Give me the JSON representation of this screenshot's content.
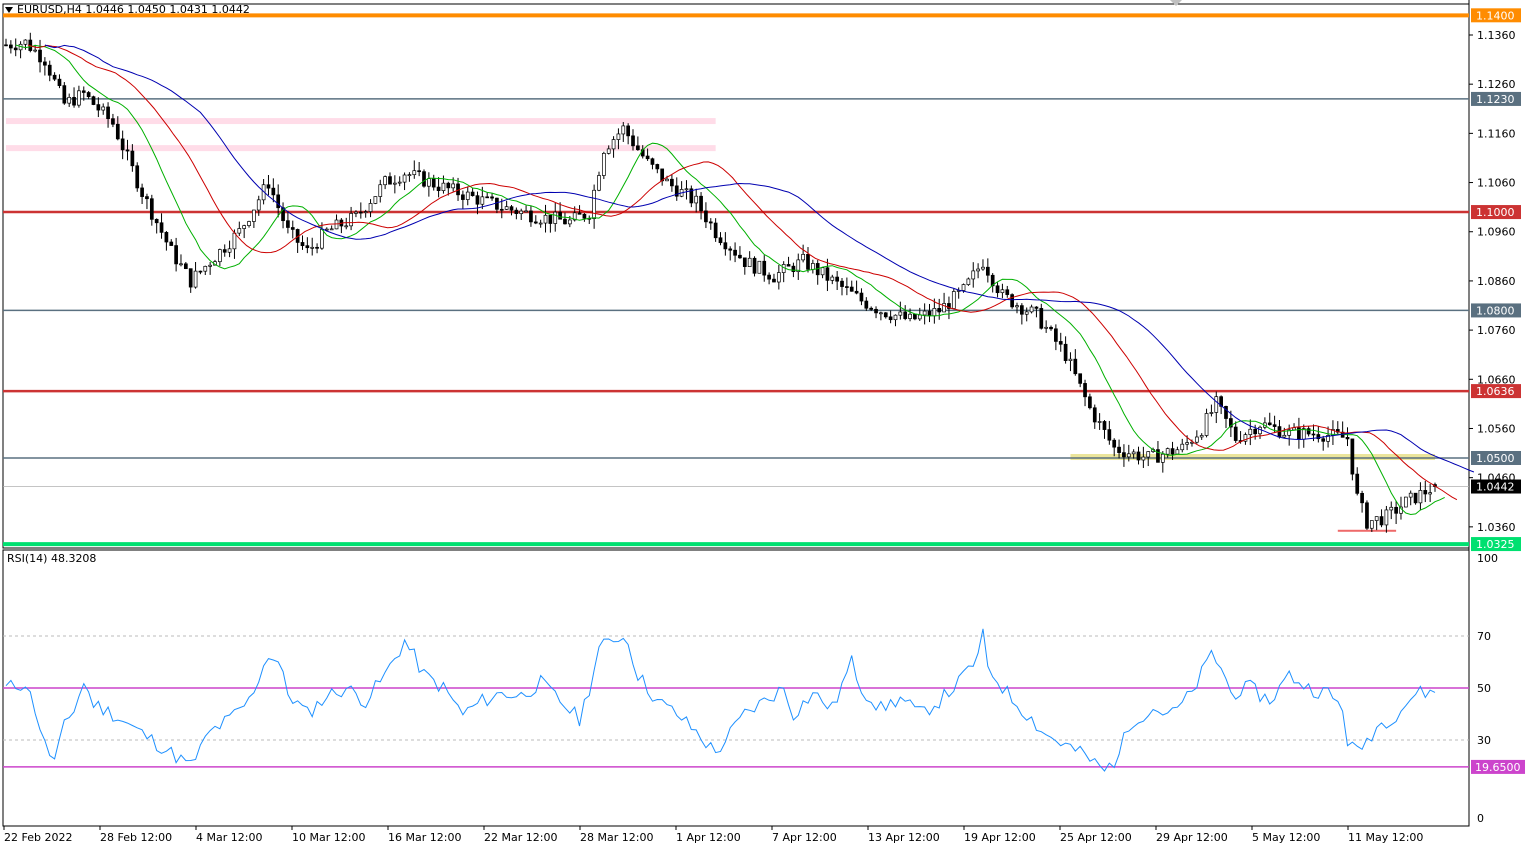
{
  "header": {
    "symbol_line": "EURUSD,H4  1.0446 1.0450 1.0431 1.0442"
  },
  "rsi_header": {
    "text": "RSI(14) 48.3208"
  },
  "colors": {
    "candle": "#000000",
    "ma_green": "#00b000",
    "ma_red": "#cc0000",
    "ma_blue": "#0000b0",
    "rsi_line": "#1e90ff",
    "level_orange": "#ff8c00",
    "level_red": "#cc3333",
    "level_gray": "#5a7080",
    "level_green": "#00e070",
    "rsi_level_magenta": "#cc44cc",
    "zone_pink": "#ffd6e4",
    "zone_yellow": "#e8e08a"
  },
  "chart_data": [
    {
      "type": "candlestick",
      "title": "EURUSD,H4",
      "timeframe": "H4",
      "ohlc_last": {
        "open": 1.0446,
        "high": 1.045,
        "low": 1.0431,
        "close": 1.0442
      },
      "current_price_label": "1.0442",
      "ylim": [
        1.0325,
        1.141
      ],
      "y_ticks": [
        "1.1360",
        "1.1260",
        "1.1160",
        "1.1060",
        "1.0960",
        "1.0860",
        "1.0760",
        "1.0660",
        "1.0560",
        "1.0460",
        "1.0360"
      ],
      "x_ticks": [
        "22 Feb 2022",
        "28 Feb 12:00",
        "4 Mar 12:00",
        "10 Mar 12:00",
        "16 Mar 12:00",
        "22 Mar 12:00",
        "28 Mar 12:00",
        "1 Apr 12:00",
        "7 Apr 12:00",
        "13 Apr 12:00",
        "19 Apr 12:00",
        "25 Apr 12:00",
        "29 Apr 12:00",
        "5 May 12:00",
        "11 May 12:00"
      ],
      "price_path": [
        [
          0,
          1.134
        ],
        [
          4,
          1.1345
        ],
        [
          8,
          1.131
        ],
        [
          12,
          1.122
        ],
        [
          16,
          1.124
        ],
        [
          22,
          1.118
        ],
        [
          28,
          1.104
        ],
        [
          34,
          1.092
        ],
        [
          38,
          1.086
        ],
        [
          44,
          1.092
        ],
        [
          48,
          1.096
        ],
        [
          54,
          1.106
        ],
        [
          58,
          1.096
        ],
        [
          62,
          1.092
        ],
        [
          66,
          1.096
        ],
        [
          72,
          1.099
        ],
        [
          78,
          1.106
        ],
        [
          82,
          1.108
        ],
        [
          90,
          1.105
        ],
        [
          96,
          1.103
        ],
        [
          102,
          1.101
        ],
        [
          110,
          1.099
        ],
        [
          116,
          1.098
        ],
        [
          120,
          1.1
        ],
        [
          123,
          1.113
        ],
        [
          127,
          1.117
        ],
        [
          132,
          1.11
        ],
        [
          136,
          1.106
        ],
        [
          142,
          1.102
        ],
        [
          146,
          1.096
        ],
        [
          152,
          1.09
        ],
        [
          158,
          1.087
        ],
        [
          164,
          1.09
        ],
        [
          170,
          1.086
        ],
        [
          176,
          1.082
        ],
        [
          180,
          1.08
        ],
        [
          186,
          1.078
        ],
        [
          192,
          1.08
        ],
        [
          197,
          1.084
        ],
        [
          201,
          1.09
        ],
        [
          205,
          1.083
        ],
        [
          212,
          1.079
        ],
        [
          218,
          1.071
        ],
        [
          223,
          1.06
        ],
        [
          228,
          1.052
        ],
        [
          235,
          1.05
        ],
        [
          242,
          1.052
        ],
        [
          246,
          1.056
        ],
        [
          249,
          1.061
        ],
        [
          253,
          1.054
        ],
        [
          258,
          1.057
        ],
        [
          264,
          1.055
        ],
        [
          270,
          1.055
        ],
        [
          276,
          1.054
        ],
        [
          278,
          1.042
        ],
        [
          280,
          1.037
        ],
        [
          284,
          1.038
        ],
        [
          288,
          1.041
        ],
        [
          294,
          1.0442
        ]
      ],
      "levels": [
        {
          "label": "1.1400",
          "value": 1.14,
          "color": "#ff8c00"
        },
        {
          "label": "1.1230",
          "value": 1.123,
          "color": "#5a7080"
        },
        {
          "label": "1.1000",
          "value": 1.1,
          "color": "#cc3333"
        },
        {
          "label": "1.0800",
          "value": 1.08,
          "color": "#5a7080"
        },
        {
          "label": "1.0636",
          "value": 1.0636,
          "color": "#cc3333"
        },
        {
          "label": "1.0500",
          "value": 1.05,
          "color": "#5a7080"
        },
        {
          "label": "1.0325",
          "value": 1.0325,
          "color": "#00e070"
        }
      ],
      "zones": [
        {
          "from_bar": 0,
          "to_bar": 146,
          "value": 1.1185,
          "color": "#ffd6e4"
        },
        {
          "from_bar": 0,
          "to_bar": 146,
          "value": 1.113,
          "color": "#ffd6e4"
        },
        {
          "from_bar": 219,
          "to_bar": 294,
          "value": 1.0502,
          "color": "#e8e08a"
        },
        {
          "from_bar": 274,
          "to_bar": 286,
          "value": 1.0352,
          "color": "#ee6a6a"
        }
      ],
      "moving_averages": [
        {
          "color": "#00b000",
          "lag": 4
        },
        {
          "color": "#cc0000",
          "lag": 9
        },
        {
          "color": "#0000b0",
          "lag": 16
        }
      ]
    },
    {
      "type": "line",
      "title": "RSI(14)",
      "value_label": "48.3208",
      "ylim": [
        0,
        100
      ],
      "y_ticks": [
        "100",
        "70",
        "50",
        "30",
        "0"
      ],
      "gridlines": [
        70,
        50,
        30
      ],
      "levels": [
        {
          "label": "",
          "value": 50,
          "color": "#cc44cc"
        },
        {
          "label": "19.6500",
          "value": 19.65,
          "color": "#cc44cc"
        }
      ],
      "rsi_path": [
        [
          0,
          50
        ],
        [
          4,
          52
        ],
        [
          6,
          42
        ],
        [
          8,
          28
        ],
        [
          10,
          22
        ],
        [
          12,
          35
        ],
        [
          14,
          42
        ],
        [
          16,
          52
        ],
        [
          18,
          44
        ],
        [
          22,
          40
        ],
        [
          26,
          35
        ],
        [
          30,
          30
        ],
        [
          34,
          25
        ],
        [
          38,
          20
        ],
        [
          42,
          33
        ],
        [
          46,
          38
        ],
        [
          50,
          45
        ],
        [
          54,
          63
        ],
        [
          56,
          60
        ],
        [
          58,
          48
        ],
        [
          62,
          40
        ],
        [
          66,
          47
        ],
        [
          70,
          50
        ],
        [
          74,
          45
        ],
        [
          78,
          55
        ],
        [
          82,
          68
        ],
        [
          84,
          62
        ],
        [
          86,
          55
        ],
        [
          90,
          50
        ],
        [
          94,
          40
        ],
        [
          98,
          45
        ],
        [
          102,
          48
        ],
        [
          106,
          47
        ],
        [
          110,
          52
        ],
        [
          114,
          45
        ],
        [
          118,
          38
        ],
        [
          120,
          50
        ],
        [
          122,
          65
        ],
        [
          126,
          70
        ],
        [
          128,
          68
        ],
        [
          130,
          55
        ],
        [
          134,
          45
        ],
        [
          138,
          40
        ],
        [
          142,
          33
        ],
        [
          146,
          25
        ],
        [
          148,
          30
        ],
        [
          152,
          40
        ],
        [
          156,
          45
        ],
        [
          160,
          50
        ],
        [
          162,
          40
        ],
        [
          166,
          48
        ],
        [
          170,
          42
        ],
        [
          174,
          60
        ],
        [
          176,
          50
        ],
        [
          180,
          42
        ],
        [
          184,
          46
        ],
        [
          188,
          40
        ],
        [
          192,
          45
        ],
        [
          196,
          52
        ],
        [
          200,
          62
        ],
        [
          201,
          70
        ],
        [
          202,
          58
        ],
        [
          206,
          48
        ],
        [
          210,
          40
        ],
        [
          214,
          32
        ],
        [
          218,
          28
        ],
        [
          222,
          24
        ],
        [
          226,
          18
        ],
        [
          228,
          22
        ],
        [
          232,
          38
        ],
        [
          236,
          42
        ],
        [
          240,
          40
        ],
        [
          244,
          48
        ],
        [
          248,
          63
        ],
        [
          250,
          58
        ],
        [
          252,
          48
        ],
        [
          256,
          50
        ],
        [
          260,
          45
        ],
        [
          264,
          55
        ],
        [
          268,
          50
        ],
        [
          272,
          48
        ],
        [
          275,
          42
        ],
        [
          276,
          30
        ],
        [
          278,
          25
        ],
        [
          282,
          35
        ],
        [
          286,
          40
        ],
        [
          290,
          48
        ],
        [
          294,
          48.32
        ]
      ]
    }
  ]
}
